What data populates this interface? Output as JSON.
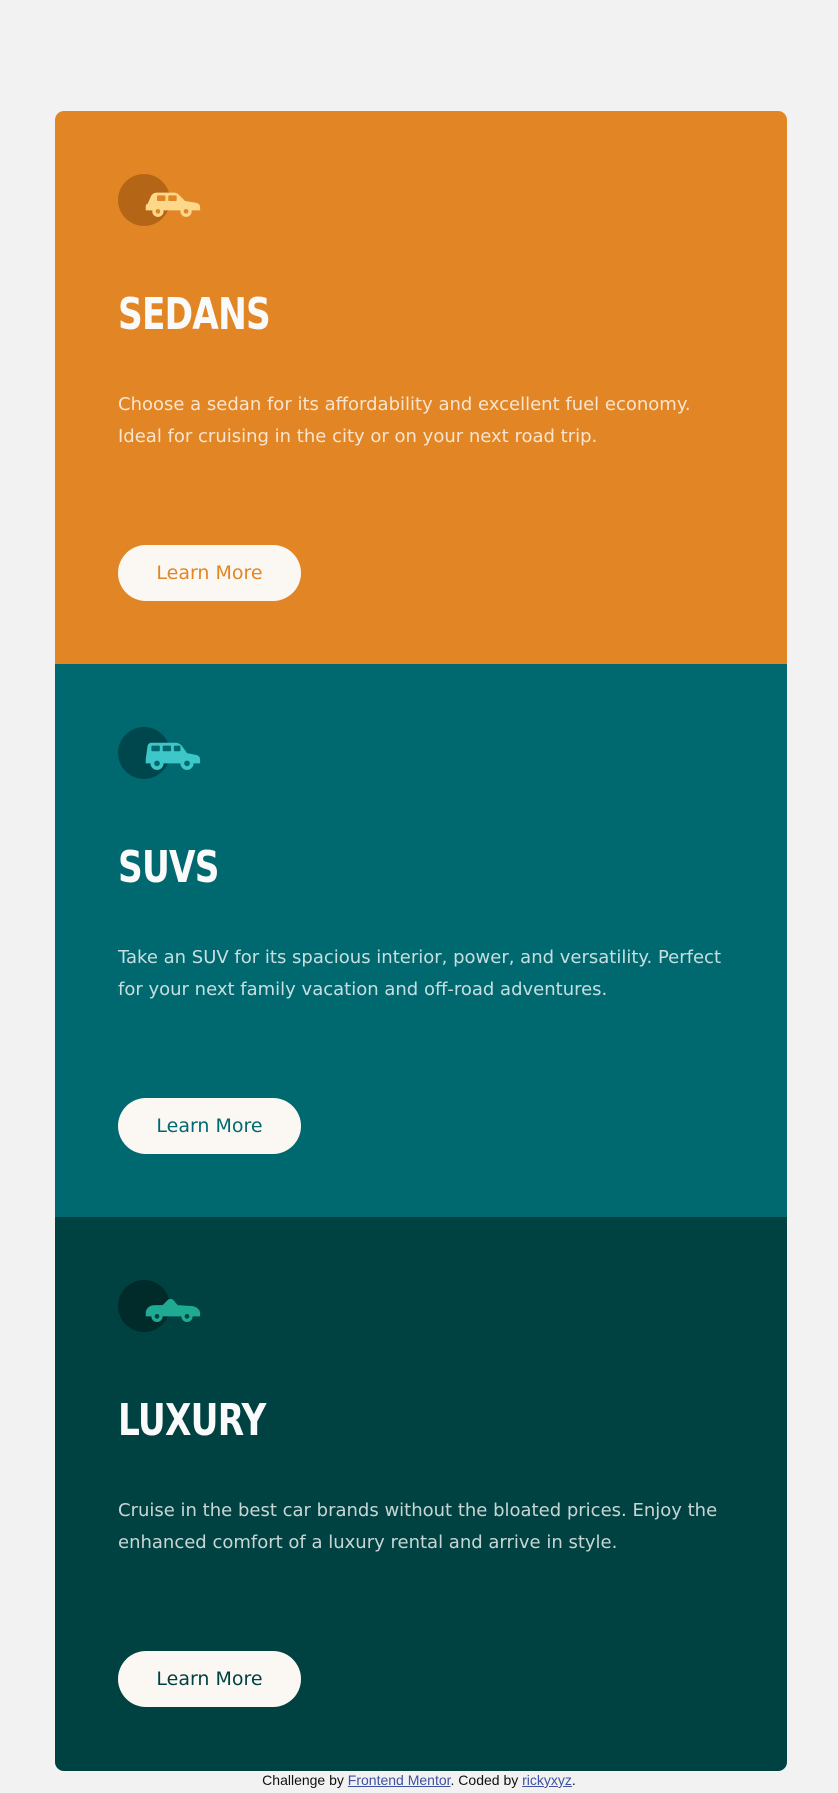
{
  "cards": [
    {
      "title": "SEDANS",
      "text": "Choose a sedan for its affordability and excellent fuel economy. Ideal for cruising in the city or on your next road trip.",
      "button": "Learn More",
      "icon": "sedan-car-icon",
      "bg": "#e28625",
      "accent": "#e28625",
      "icon_color": "#fdd88a",
      "bubble": "#b46516"
    },
    {
      "title": "SUVS",
      "text": "Take an SUV for its spacious interior, power, and versatility. Perfect for your next family vacation and off-road adventures.",
      "button": "Learn More",
      "icon": "suv-car-icon",
      "bg": "#006970",
      "accent": "#006970",
      "icon_color": "#3ec7c9",
      "bubble": "#00474d"
    },
    {
      "title": "LUXURY",
      "text": "Cruise in the best car brands without the bloated prices. Enjoy the enhanced comfort of a luxury rental and arrive in style.",
      "button": "Learn More",
      "icon": "luxury-car-icon",
      "bg": "#004241",
      "accent": "#004241",
      "icon_color": "#1eaa93",
      "bubble": "#002b2a"
    }
  ],
  "footer": {
    "prefix": "Challenge by ",
    "link1": "Frontend Mentor",
    "middle": ". Coded by ",
    "link2": "rickyxyz",
    "suffix": "."
  }
}
